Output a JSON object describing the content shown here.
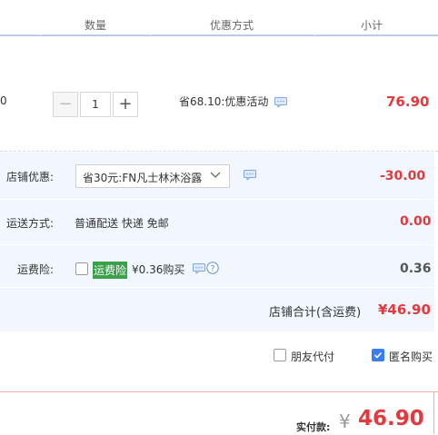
{
  "header": {
    "qty": "数量",
    "discount": "优惠方式",
    "subtotal": "小计"
  },
  "product": {
    "left_stub": "0",
    "quantity": "1",
    "discount_text": "省68.10:优惠活动",
    "subtotal": "76.90"
  },
  "shop": {
    "coupon_label": "店铺优惠:",
    "coupon_selected": "省30元:FN凡士林沐浴露",
    "coupon_amount": "-30.00",
    "shipping_label": "运送方式:",
    "shipping_text": "普通配送 快递 免邮",
    "shipping_amount": "0.00",
    "insurance_label": "运费险:",
    "insurance_tag": "运费险",
    "insurance_price": "¥0.36购买",
    "insurance_amount": "0.36",
    "total_label": "店铺合计(含运费)",
    "total_amount": "¥46.90"
  },
  "options": {
    "friend_pay": "朋友代付",
    "anonymous": "匿名购买",
    "friend_pay_checked": false,
    "anonymous_checked": true
  },
  "footer": {
    "pay_label": "实付款:",
    "currency": "¥",
    "pay_amount": "46.90"
  },
  "colors": {
    "accent_red": "#e4393c",
    "header_line": "#b9cce6",
    "shop_bg": "#f2f7ff",
    "check_blue": "#3b7ef0"
  }
}
